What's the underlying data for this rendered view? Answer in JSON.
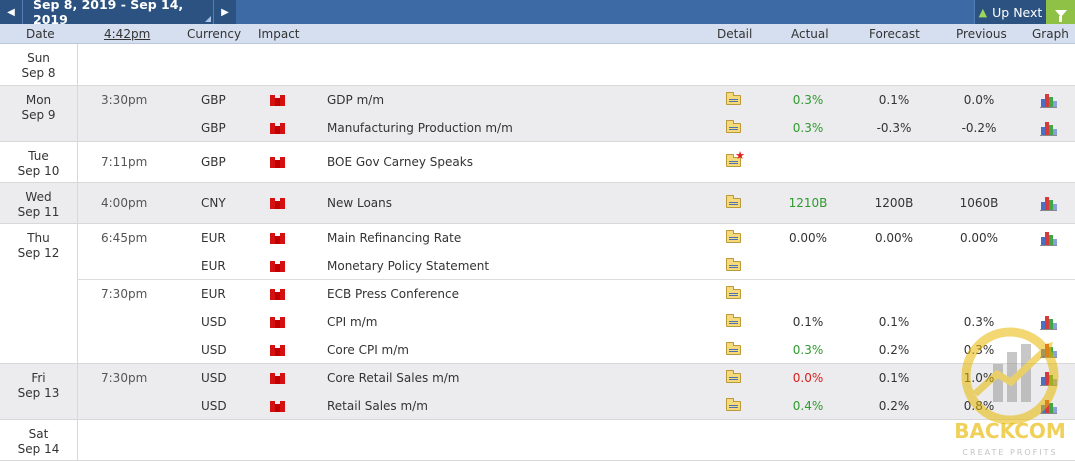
{
  "nav": {
    "prev_icon": "◀",
    "date_range": "Sep 8, 2019 - Sep 14, 2019",
    "next_icon": "▶",
    "up_next_label": "Up Next",
    "up_next_icon": "▲"
  },
  "columns": {
    "date": "Date",
    "time": "4:42pm",
    "currency": "Currency",
    "impact": "Impact",
    "detail": "Detail",
    "actual": "Actual",
    "forecast": "Forecast",
    "previous": "Previous",
    "graph": "Graph"
  },
  "days": [
    {
      "weekday": "Sun",
      "date": "Sep 8"
    },
    {
      "weekday": "Mon",
      "date": "Sep 9"
    },
    {
      "weekday": "Tue",
      "date": "Sep 10"
    },
    {
      "weekday": "Wed",
      "date": "Sep 11"
    },
    {
      "weekday": "Thu",
      "date": "Sep 12"
    },
    {
      "weekday": "Fri",
      "date": "Sep 13"
    },
    {
      "weekday": "Sat",
      "date": "Sep 14"
    }
  ],
  "events": [
    {
      "time": "3:30pm",
      "currency": "GBP",
      "impact": "high",
      "name": "GDP m/m",
      "detail_icon": "folder-icon",
      "actual": "0.3%",
      "actual_status": "better",
      "forecast": "0.1%",
      "previous": "0.0%",
      "has_graph": true
    },
    {
      "time": "",
      "currency": "GBP",
      "impact": "high",
      "name": "Manufacturing Production m/m",
      "detail_icon": "folder-icon",
      "actual": "0.3%",
      "actual_status": "better",
      "forecast": "-0.3%",
      "previous": "-0.2%",
      "has_graph": true
    },
    {
      "time": "7:11pm",
      "currency": "GBP",
      "impact": "high",
      "name": "BOE Gov Carney Speaks",
      "detail_icon": "folder-star-icon",
      "actual": "",
      "actual_status": "",
      "forecast": "",
      "previous": "",
      "has_graph": false
    },
    {
      "time": "4:00pm",
      "currency": "CNY",
      "impact": "high",
      "name": "New Loans",
      "detail_icon": "folder-icon",
      "actual": "1210B",
      "actual_status": "better",
      "forecast": "1200B",
      "previous": "1060B",
      "has_graph": true
    },
    {
      "time": "6:45pm",
      "currency": "EUR",
      "impact": "high",
      "name": "Main Refinancing Rate",
      "detail_icon": "folder-icon",
      "actual": "0.00%",
      "actual_status": "neutral",
      "forecast": "0.00%",
      "previous": "0.00%",
      "has_graph": true
    },
    {
      "time": "",
      "currency": "EUR",
      "impact": "high",
      "name": "Monetary Policy Statement",
      "detail_icon": "folder-icon",
      "actual": "",
      "actual_status": "",
      "forecast": "",
      "previous": "",
      "has_graph": false
    },
    {
      "time": "7:30pm",
      "currency": "EUR",
      "impact": "high",
      "name": "ECB Press Conference",
      "detail_icon": "folder-icon",
      "actual": "",
      "actual_status": "",
      "forecast": "",
      "previous": "",
      "has_graph": false
    },
    {
      "time": "",
      "currency": "USD",
      "impact": "high",
      "name": "CPI m/m",
      "detail_icon": "folder-icon",
      "actual": "0.1%",
      "actual_status": "neutral",
      "forecast": "0.1%",
      "previous": "0.3%",
      "has_graph": true
    },
    {
      "time": "",
      "currency": "USD",
      "impact": "high",
      "name": "Core CPI m/m",
      "detail_icon": "folder-icon",
      "actual": "0.3%",
      "actual_status": "better",
      "forecast": "0.2%",
      "previous": "0.3%",
      "has_graph": true
    },
    {
      "time": "7:30pm",
      "currency": "USD",
      "impact": "high",
      "name": "Core Retail Sales m/m",
      "detail_icon": "folder-icon",
      "actual": "0.0%",
      "actual_status": "worse",
      "forecast": "0.1%",
      "previous": "1.0%",
      "has_graph": true
    },
    {
      "time": "",
      "currency": "USD",
      "impact": "high",
      "name": "Retail Sales m/m",
      "detail_icon": "folder-icon",
      "actual": "0.4%",
      "actual_status": "better",
      "forecast": "0.2%",
      "previous": "0.8%",
      "has_graph": true
    }
  ],
  "watermark": {
    "name": "BACKCOM",
    "tagline": "CREATE PROFITS"
  },
  "colors": {
    "nav_bg": "#2b5280",
    "header_bg": "#d5dfef",
    "shaded_row": "#ececee",
    "better": "#2e9a2e",
    "worse": "#d42020",
    "impact_high": "#d41010",
    "filter": "#8fc147"
  }
}
